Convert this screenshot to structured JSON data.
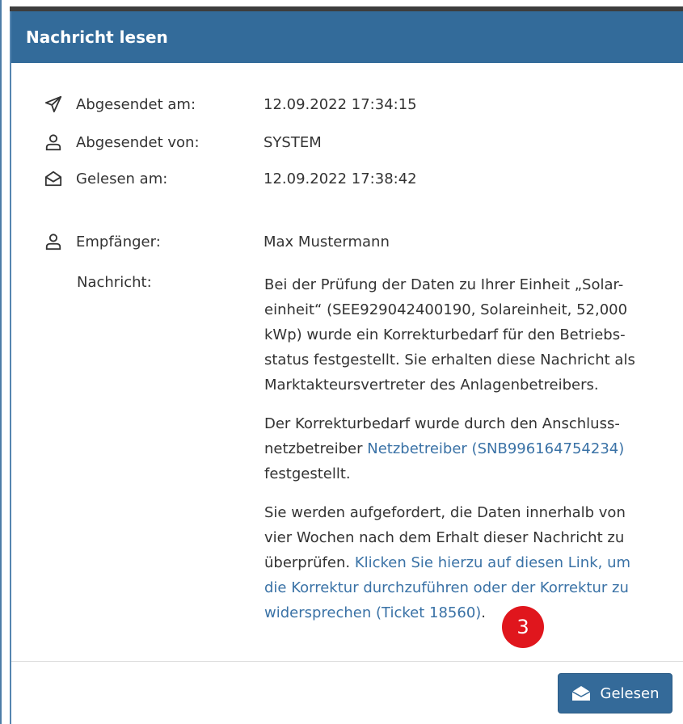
{
  "dialog": {
    "title": "Nachricht lesen",
    "accent_color": "#336b9a",
    "link_color": "#3a72a6"
  },
  "meta": {
    "sent_at": {
      "icon": "paper-plane-icon",
      "label": "Abgesendet am:",
      "value": "12.09.2022 17:34:15"
    },
    "sent_by": {
      "icon": "user-icon",
      "label": "Abgesendet von:",
      "value": "SYSTEM"
    },
    "read_at": {
      "icon": "envelope-open-icon",
      "label": "Gelesen am:",
      "value": "12.09.2022 17:38:42"
    },
    "recipient": {
      "icon": "user-icon",
      "label": "Empfänger:",
      "value": "Max Mustermann"
    },
    "message_label": "Nachricht:"
  },
  "message": {
    "p1": "Bei der Prüfung der Daten zu Ihrer Einheit „Solar-einheit“ (SEE929042400190, Solareinheit, 52,000 kWp) wurde ein Korrekturbedarf für den Betriebs-status festgestellt. Sie erhalten diese Nachricht als Marktakteursvertreter des Anlagenbetreibers.",
    "p2_before": "Der Korrekturbedarf wurde durch den Anschluss-netzbetreiber ",
    "p2_link": "Netzbetreiber (SNB996164754234)",
    "p2_after": " festgestellt.",
    "p3_before": "Sie werden aufgefordert, die Daten innerhalb von vier Wochen nach dem Erhalt dieser Nachricht zu überprüfen. ",
    "p3_link": "Klicken Sie hierzu auf diesen Link, um die Korrektur durchzuführen oder der Korrektur zu widersprechen (Ticket 18560)",
    "p3_after": "."
  },
  "annotation": {
    "badge_number": "3",
    "badge_color": "#e0161d"
  },
  "footer": {
    "read_button_label": "Gelesen",
    "read_button_icon": "envelope-open-icon"
  }
}
